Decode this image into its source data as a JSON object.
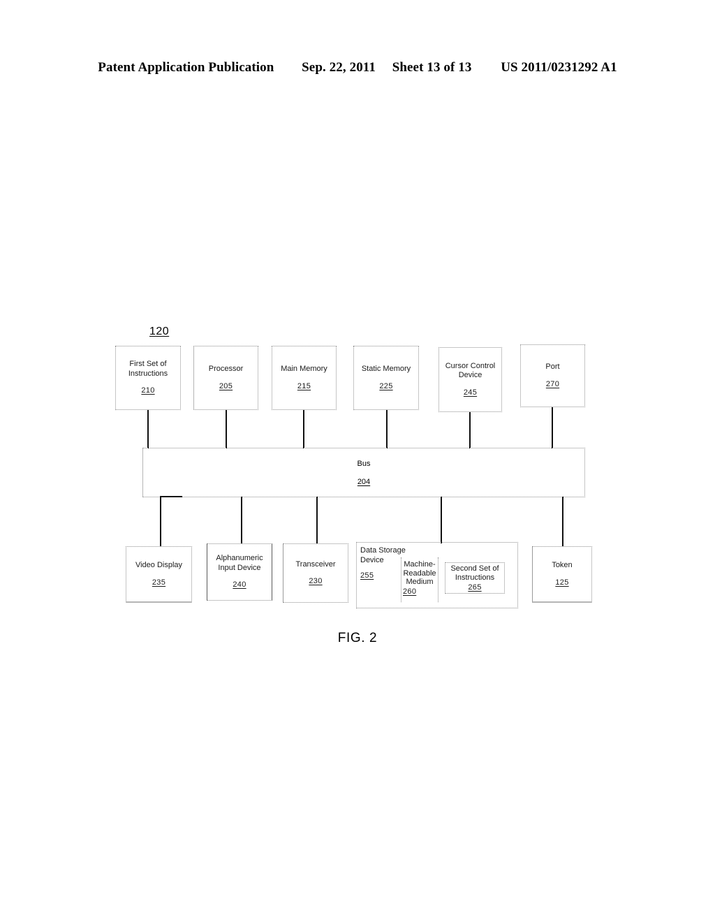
{
  "header": {
    "publication": "Patent Application Publication",
    "date": "Sep. 22, 2011",
    "sheet": "Sheet 13 of 13",
    "patent_number": "US 2011/0231292 A1"
  },
  "figure": {
    "system_ref": "120",
    "caption": "FIG. 2",
    "bus": {
      "label": "Bus",
      "ref": "204"
    },
    "top_row": [
      {
        "label": "First Set of\nInstructions",
        "ref": "210"
      },
      {
        "label": "Processor",
        "ref": "205"
      },
      {
        "label": "Main Memory",
        "ref": "215"
      },
      {
        "label": "Static Memory",
        "ref": "225"
      },
      {
        "label": "Cursor Control\nDevice",
        "ref": "245"
      },
      {
        "label": "Port",
        "ref": "270"
      }
    ],
    "bottom_row": [
      {
        "label": "Video Display",
        "ref": "235"
      },
      {
        "label": "Alphanumeric\nInput Device",
        "ref": "240"
      },
      {
        "label": "Transceiver",
        "ref": "230"
      },
      {
        "label": "Data Storage\nDevice",
        "ref": "255"
      },
      {
        "label": "Token",
        "ref": "125"
      }
    ],
    "nested": {
      "machine_readable_medium": {
        "label": "Machine-\nReadable\nMedium",
        "ref": "260"
      },
      "second_set_of_instructions": {
        "label": "Second Set of\nInstructions",
        "ref": "265"
      }
    }
  }
}
